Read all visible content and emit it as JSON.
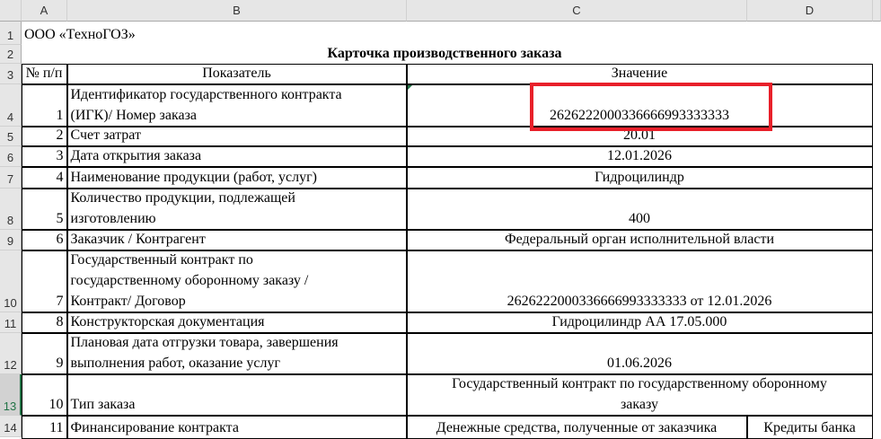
{
  "columns": [
    "A",
    "B",
    "C",
    "D"
  ],
  "rows": [
    "1",
    "2",
    "3",
    "4",
    "5",
    "6",
    "7",
    "8",
    "9",
    "10",
    "11",
    "12",
    "13",
    "14"
  ],
  "company": "ООО «ТехноГОЗ»",
  "title": "Карточка производственного заказа",
  "headers": {
    "num": "№ п/п",
    "indicator": "Показатель",
    "value": "Значение"
  },
  "items": [
    {
      "n": "1",
      "label1": "Идентификатор государственного контракта",
      "label2": "(ИГК)/ Номер заказа",
      "value": "2626222000336666993333333"
    },
    {
      "n": "2",
      "label": "Счет затрат",
      "value": "20.01"
    },
    {
      "n": "3",
      "label": "Дата открытия заказа",
      "value": "12.01.2026"
    },
    {
      "n": "4",
      "label": "Наименование продукции (работ, услуг)",
      "value": "Гидроцилиндр"
    },
    {
      "n": "5",
      "label1": "Количество продукции, подлежащей",
      "label2": "изготовлению",
      "value": "400"
    },
    {
      "n": "6",
      "label": "Заказчик / Контрагент",
      "value": "Федеральный орган исполнительной власти"
    },
    {
      "n": "7",
      "label1": "Государственный контракт по",
      "label2": "государственному оборонному заказу /",
      "label3": "Контракт/ Договор",
      "value": "2626222000336666993333333 от 12.01.2026"
    },
    {
      "n": "8",
      "label": "Конструкторская документация",
      "value": "Гидроцилиндр АА 17.05.000"
    },
    {
      "n": "9",
      "label1": "Плановая дата отгрузки товара, завершения",
      "label2": "выполнения работ, оказание услуг",
      "value": "01.06.2026"
    },
    {
      "n": "10",
      "label": "Тип заказа",
      "value1": "Государственный контракт по государственному оборонному",
      "value2": "заказу"
    },
    {
      "n": "11",
      "label": "Финансирование контракта",
      "value": "Денежные средства, полученные от заказчика",
      "value_d": "Кредиты банка"
    }
  ]
}
